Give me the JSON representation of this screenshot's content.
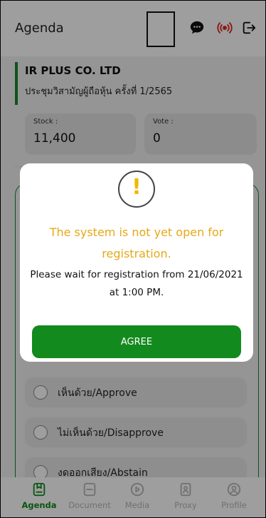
{
  "header": {
    "title": "Agenda"
  },
  "company": {
    "name": "IR PLUS CO. LTD",
    "meeting": "ประชุมวิสามัญผู้ถือหุ้น ครั้งที่ 1/2565"
  },
  "stats": [
    {
      "label": "Stock :",
      "value": "11,400"
    },
    {
      "label": "Vote :",
      "value": "0"
    }
  ],
  "options": [
    {
      "label": "เห็นด้วย/Approve"
    },
    {
      "label": "ไม่เห็นด้วย/Disapprove"
    },
    {
      "label": "งดออกเสียง/Abstain"
    }
  ],
  "modal": {
    "headline": "The system is not yet open for registration.",
    "message": "Please wait for registration from 21/06/2021 at 1:00 PM.",
    "agree_label": "AGREE"
  },
  "nav": [
    {
      "label": "Agenda",
      "icon": "agenda-icon",
      "active": true
    },
    {
      "label": "Document",
      "icon": "document-icon",
      "active": false
    },
    {
      "label": "Media",
      "icon": "media-icon",
      "active": false
    },
    {
      "label": "Proxy",
      "icon": "proxy-icon",
      "active": false
    },
    {
      "label": "Profile",
      "icon": "profile-icon",
      "active": false
    }
  ],
  "colors": {
    "primary": "#138a1e",
    "warning": "#e6a817",
    "live": "#e0251b",
    "muted": "#b5b5b5"
  }
}
